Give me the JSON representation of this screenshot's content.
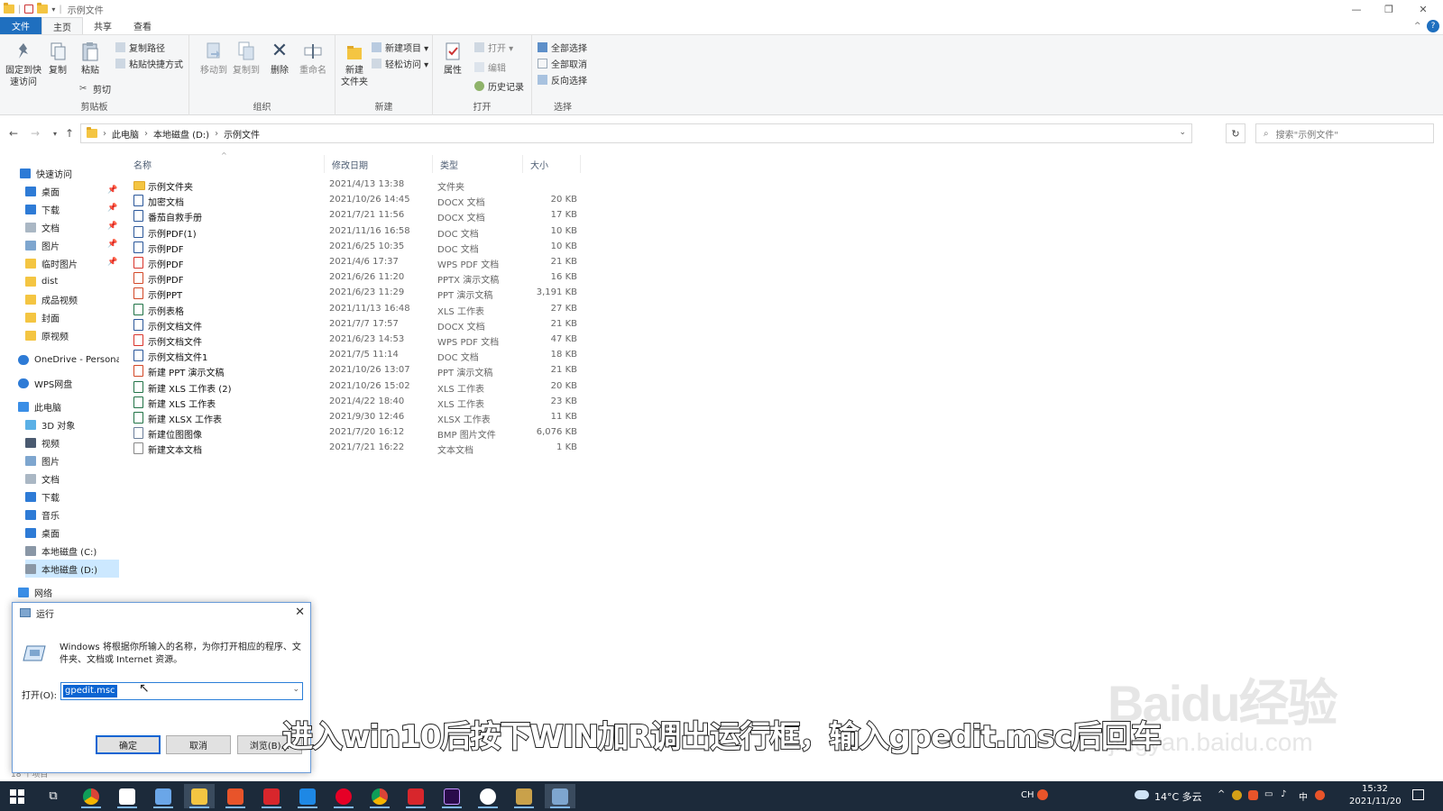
{
  "window": {
    "title": "示例文件"
  },
  "ribbon": {
    "tabs": [
      "文件",
      "主页",
      "共享",
      "查看"
    ],
    "clipboard": {
      "pin": "固定到快\n速访问",
      "copy": "复制",
      "paste": "粘贴",
      "copy_path": "复制路径",
      "paste_shortcut": "粘贴快捷方式",
      "cut": "剪切",
      "label": "剪贴板"
    },
    "organize": {
      "move_to": "移动到",
      "copy_to": "复制到",
      "delete": "删除",
      "rename": "重命名",
      "label": "组织"
    },
    "new": {
      "new_folder": "新建\n文件夹",
      "new_item": "新建项目 ▾",
      "easy_access": "轻松访问 ▾",
      "label": "新建"
    },
    "open": {
      "properties": "属性",
      "open": "打开 ▾",
      "edit": "编辑",
      "history": "历史记录",
      "label": "打开"
    },
    "select": {
      "select_all": "全部选择",
      "select_none": "全部取消",
      "invert": "反向选择",
      "label": "选择"
    }
  },
  "address": {
    "crumbs": [
      "此电脑",
      "本地磁盘 (D:)",
      "示例文件"
    ],
    "search_placeholder": "搜索\"示例文件\""
  },
  "nav": {
    "quick_access": "快速访问",
    "quick_items": [
      "桌面",
      "下载",
      "文档",
      "图片",
      "临时图片",
      "dist",
      "成品视频",
      "封面",
      "原视频"
    ],
    "onedrive": "OneDrive - Persona",
    "wps": "WPS网盘",
    "this_pc": "此电脑",
    "pc_items": [
      "3D 对象",
      "视频",
      "图片",
      "文档",
      "下载",
      "音乐",
      "桌面",
      "本地磁盘 (C:)",
      "本地磁盘 (D:)"
    ],
    "network": "网络"
  },
  "columns": {
    "name": "名称",
    "date": "修改日期",
    "type": "类型",
    "size": "大小"
  },
  "files": [
    {
      "name": "示例文件夹",
      "date": "2021/4/13 13:38",
      "type": "文件夹",
      "size": "",
      "kind": "folder"
    },
    {
      "name": "加密文档",
      "date": "2021/10/26 14:45",
      "type": "DOCX 文档",
      "size": "20 KB",
      "kind": "doc"
    },
    {
      "name": "番茄自救手册",
      "date": "2021/7/21 11:56",
      "type": "DOCX 文档",
      "size": "17 KB",
      "kind": "doc"
    },
    {
      "name": "示例PDF(1)",
      "date": "2021/11/16 16:58",
      "type": "DOC 文档",
      "size": "10 KB",
      "kind": "doc"
    },
    {
      "name": "示例PDF",
      "date": "2021/6/25 10:35",
      "type": "DOC 文档",
      "size": "10 KB",
      "kind": "doc"
    },
    {
      "name": "示例PDF",
      "date": "2021/4/6 17:37",
      "type": "WPS PDF 文档",
      "size": "21 KB",
      "kind": "pdf"
    },
    {
      "name": "示例PDF",
      "date": "2021/6/26 11:20",
      "type": "PPTX 演示文稿",
      "size": "16 KB",
      "kind": "ppt"
    },
    {
      "name": "示例PPT",
      "date": "2021/6/23 11:29",
      "type": "PPT 演示文稿",
      "size": "3,191 KB",
      "kind": "ppt"
    },
    {
      "name": "示例表格",
      "date": "2021/11/13 16:48",
      "type": "XLS 工作表",
      "size": "27 KB",
      "kind": "xls"
    },
    {
      "name": "示例文档文件",
      "date": "2021/7/7 17:57",
      "type": "DOCX 文档",
      "size": "21 KB",
      "kind": "doc"
    },
    {
      "name": "示例文档文件",
      "date": "2021/6/23 14:53",
      "type": "WPS PDF 文档",
      "size": "47 KB",
      "kind": "pdf"
    },
    {
      "name": "示例文档文件1",
      "date": "2021/7/5 11:14",
      "type": "DOC 文档",
      "size": "18 KB",
      "kind": "doc"
    },
    {
      "name": "新建 PPT 演示文稿",
      "date": "2021/10/26 13:07",
      "type": "PPT 演示文稿",
      "size": "21 KB",
      "kind": "ppt"
    },
    {
      "name": "新建 XLS 工作表 (2)",
      "date": "2021/10/26 15:02",
      "type": "XLS 工作表",
      "size": "20 KB",
      "kind": "xls"
    },
    {
      "name": "新建 XLS 工作表",
      "date": "2021/4/22 18:40",
      "type": "XLS 工作表",
      "size": "23 KB",
      "kind": "xls"
    },
    {
      "name": "新建 XLSX 工作表",
      "date": "2021/9/30 12:46",
      "type": "XLSX 工作表",
      "size": "11 KB",
      "kind": "xls"
    },
    {
      "name": "新建位图图像",
      "date": "2021/7/20 16:12",
      "type": "BMP 图片文件",
      "size": "6,076 KB",
      "kind": "bmp"
    },
    {
      "name": "新建文本文档",
      "date": "2021/7/21 16:22",
      "type": "文本文档",
      "size": "1 KB",
      "kind": "txt"
    }
  ],
  "status": {
    "count": "18 个项目"
  },
  "run": {
    "title": "运行",
    "desc": "Windows 将根据你所输入的名称，为你打开相应的程序、文件夹、文档或 Internet 资源。",
    "open_label": "打开(O):",
    "value": "gpedit.msc",
    "ok": "确定",
    "cancel": "取消",
    "browse": "浏览(B)..."
  },
  "subtitle": "进入win10后按下WIN加R调出运行框，输入gpedit.msc后回车",
  "watermark": {
    "main": "Baidu经验",
    "sub": "jingyan.baidu.com"
  },
  "tray": {
    "weather": "14°C 多云",
    "ime": "中",
    "ch": "CH",
    "time": "15:32",
    "date": "2021/11/20"
  },
  "colors": {
    "accent": "#1f6fbf",
    "folder": "#f4c542",
    "taskbar": "#1c2a3a",
    "selection": "#cce8ff"
  }
}
